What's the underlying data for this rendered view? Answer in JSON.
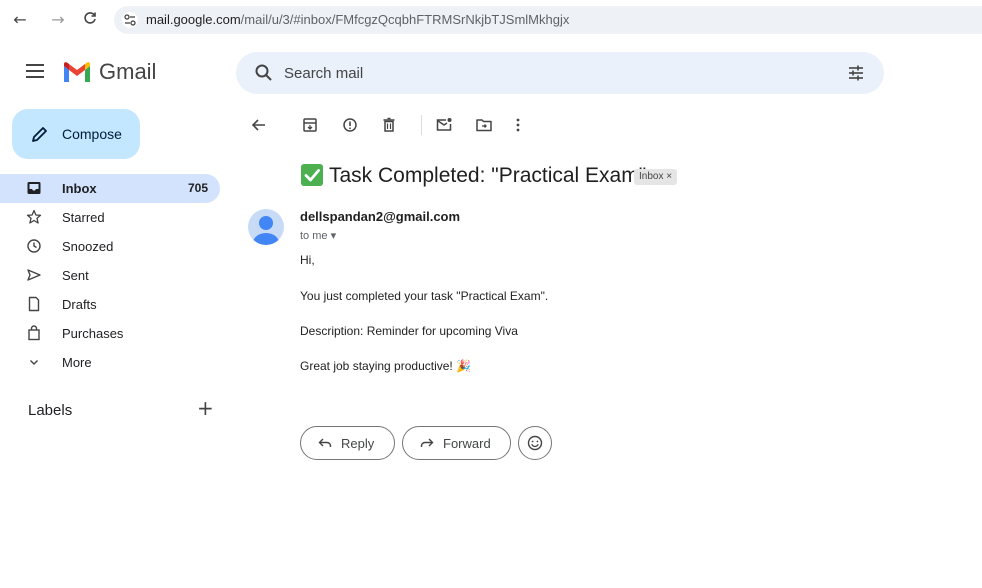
{
  "browser": {
    "back": "←",
    "forward": "→",
    "reload": "C",
    "url_host": "mail.google.com",
    "url_path": "/mail/u/3/#inbox/FMfcgzQcqbhFTRMSrNkjbTJSmlMkhgjx"
  },
  "app": {
    "name": "Gmail"
  },
  "search": {
    "placeholder": "Search mail"
  },
  "sidebar": {
    "compose_label": "Compose",
    "items": [
      {
        "label": "Inbox",
        "count": "705",
        "icon": "inbox-icon"
      },
      {
        "label": "Starred",
        "count": "",
        "icon": "star-icon"
      },
      {
        "label": "Snoozed",
        "count": "",
        "icon": "clock-icon"
      },
      {
        "label": "Sent",
        "count": "",
        "icon": "send-icon"
      },
      {
        "label": "Drafts",
        "count": "",
        "icon": "draft-icon"
      },
      {
        "label": "Purchases",
        "count": "",
        "icon": "shopping-bag-icon"
      },
      {
        "label": "More",
        "count": "",
        "icon": "chevron-down-icon"
      }
    ],
    "labels_title": "Labels",
    "labels_add": "+"
  },
  "email": {
    "subject": "Task Completed: \"Practical Exam\"",
    "chip": "Inbox ×",
    "sender": "dellspandan2@gmail.com",
    "recipient_line": "to me ▾",
    "body": [
      "Hi,",
      "You just completed your task \"Practical Exam\".",
      "Description: Reminder for upcoming Viva",
      "Great job staying productive! 🎉"
    ],
    "reply_label": "Reply",
    "forward_label": "Forward"
  },
  "colors": {
    "compose_bg": "#c2e7ff",
    "active_nav_bg": "#d3e3fd",
    "search_bg": "#eaf1fb",
    "check_green": "#4caf50"
  }
}
